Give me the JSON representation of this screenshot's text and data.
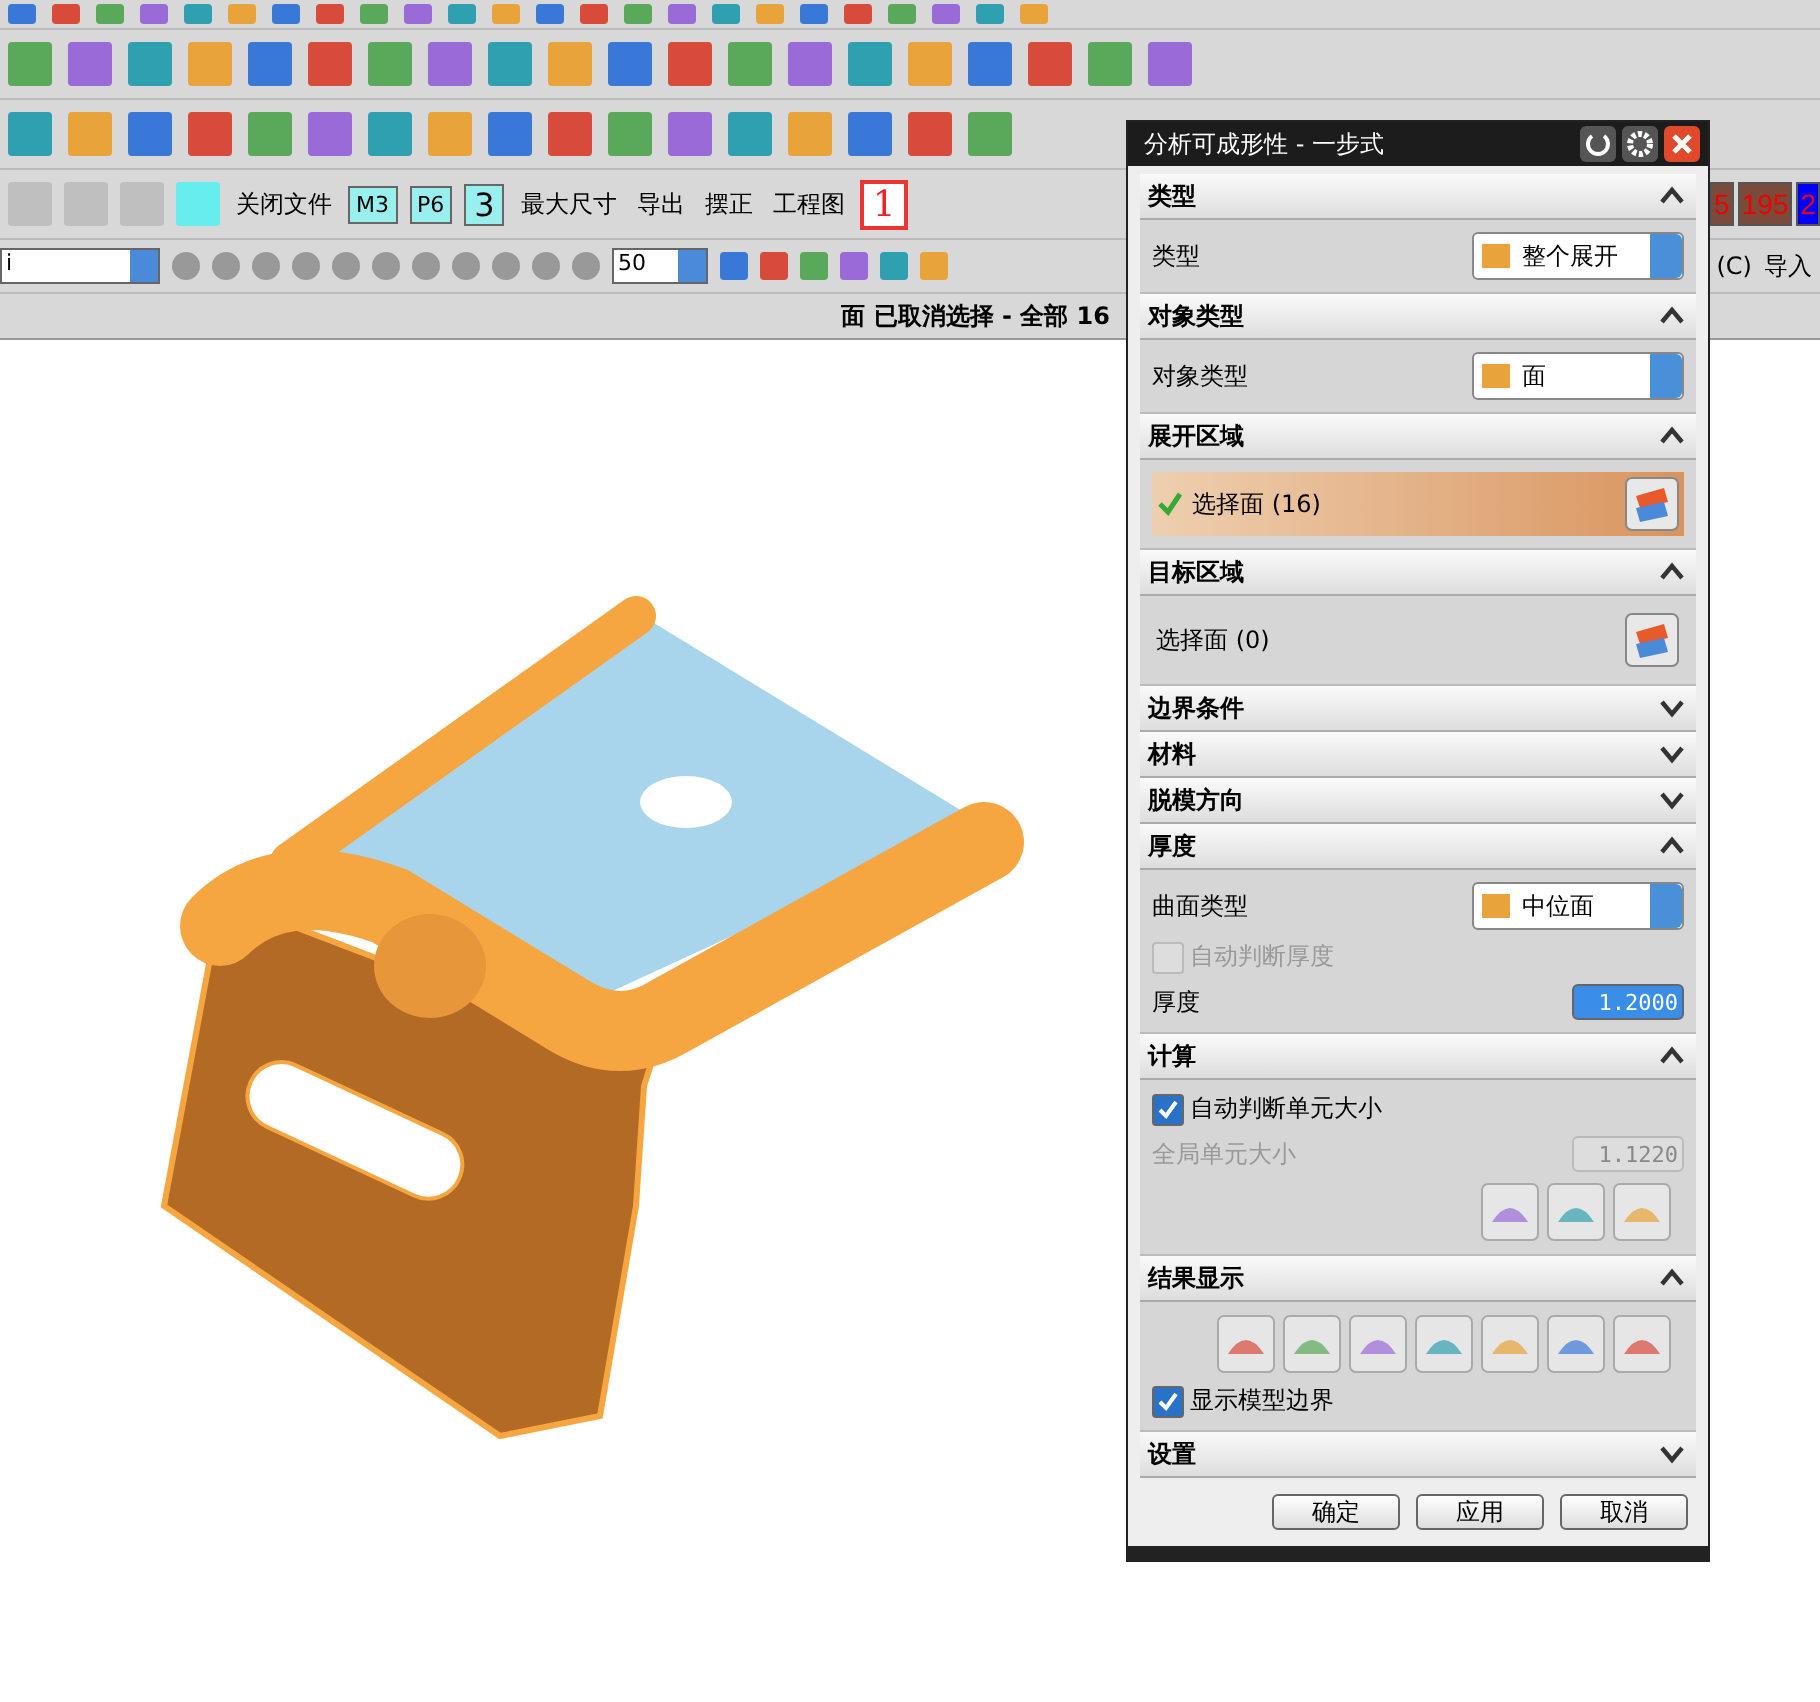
{
  "toolbar": {
    "row4": [
      {
        "kind": "text",
        "label": "关闭文件"
      },
      {
        "kind": "box",
        "label": "M3"
      },
      {
        "kind": "box",
        "label": "P6"
      },
      {
        "kind": "big",
        "label": "3"
      },
      {
        "kind": "text",
        "label": "最大尺寸"
      },
      {
        "kind": "text",
        "label": "导出"
      },
      {
        "kind": "text",
        "label": "摆正"
      },
      {
        "kind": "text",
        "label": "工程图"
      },
      {
        "kind": "red",
        "label": "1"
      }
    ],
    "row4_right": [
      {
        "kind": "brown",
        "label": "5"
      },
      {
        "kind": "brown",
        "label": "195"
      },
      {
        "kind": "blue",
        "label": "2"
      }
    ],
    "layer_field": "i",
    "scale_field": "50",
    "row5_right": [
      "(C)",
      "导入"
    ]
  },
  "status": "面 已取消选择 - 全部 16",
  "dialog": {
    "title": "分析可成形性 - 一步式",
    "sections": [
      {
        "title": "类型",
        "expanded": true,
        "items": [
          {
            "kind": "dropdown",
            "label": "类型",
            "value": "整个展开"
          }
        ]
      },
      {
        "title": "对象类型",
        "expanded": true,
        "items": [
          {
            "kind": "dropdown",
            "label": "对象类型",
            "value": "面"
          }
        ]
      },
      {
        "title": "展开区域",
        "expanded": true,
        "items": [
          {
            "kind": "selection",
            "label": "选择面 (16)",
            "selected": true
          }
        ]
      },
      {
        "title": "目标区域",
        "expanded": true,
        "items": [
          {
            "kind": "selection",
            "label": "选择面 (0)",
            "selected": false
          }
        ]
      },
      {
        "title": "边界条件",
        "expanded": false
      },
      {
        "title": "材料",
        "expanded": false
      },
      {
        "title": "脱模方向",
        "expanded": false
      },
      {
        "title": "厚度",
        "expanded": true,
        "items": [
          {
            "kind": "dropdown",
            "label": "曲面类型",
            "value": "中位面"
          },
          {
            "kind": "checkbox",
            "label": "自动判断厚度",
            "checked": false,
            "disabled": true
          },
          {
            "kind": "number",
            "label": "厚度",
            "value": "1.2000",
            "disabled": false
          }
        ]
      },
      {
        "title": "计算",
        "expanded": true,
        "items": [
          {
            "kind": "checkbox",
            "label": "自动判断单元大小",
            "checked": true,
            "disabled": false
          },
          {
            "kind": "number",
            "label": "全局单元大小",
            "value": "1.1220",
            "disabled": true
          },
          {
            "kind": "mesh_tools"
          }
        ]
      },
      {
        "title": "结果显示",
        "expanded": true,
        "items": [
          {
            "kind": "result_tools"
          },
          {
            "kind": "checkbox",
            "label": "显示模型边界",
            "checked": true,
            "disabled": false
          }
        ]
      },
      {
        "title": "设置",
        "expanded": false
      }
    ],
    "buttons": [
      "确定",
      "应用",
      "取消"
    ]
  }
}
